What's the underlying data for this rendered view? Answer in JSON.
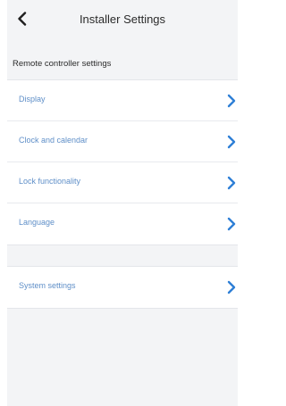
{
  "header": {
    "title": "Installer Settings",
    "back_icon": "chevron-left-icon"
  },
  "section": {
    "title": "Remote controller settings"
  },
  "menu": {
    "items": [
      {
        "label": "Display",
        "icon": "chevron-right-icon"
      },
      {
        "label": "Clock and calendar",
        "icon": "chevron-right-icon"
      },
      {
        "label": "Lock functionality",
        "icon": "chevron-right-icon"
      },
      {
        "label": "Language",
        "icon": "chevron-right-icon"
      }
    ],
    "system_item": {
      "label": "System settings",
      "icon": "chevron-right-icon"
    }
  },
  "colors": {
    "accent": "#2e7fd6",
    "label": "#5f8fc8",
    "background": "#f3f4f6"
  }
}
